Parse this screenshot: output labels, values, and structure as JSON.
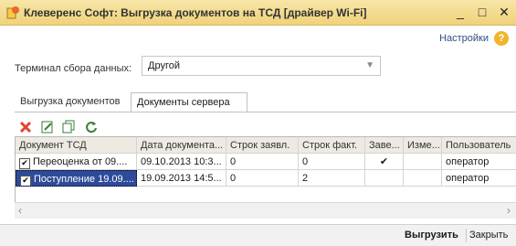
{
  "window": {
    "title": "Клеверенс Софт: Выгрузка документов на ТСД [драйвер Wi-Fi]",
    "minimize": "_",
    "maximize": "□",
    "close": "✕"
  },
  "header": {
    "settings_label": "Настройки",
    "help": "?"
  },
  "terminal": {
    "label": "Терминал сбора данных:",
    "value": "Другой"
  },
  "tabs": [
    {
      "label": "Выгрузка документов"
    },
    {
      "label": "Документы сервера"
    }
  ],
  "toolbar": {
    "icons": [
      "delete-icon",
      "edit-icon",
      "copy-icon",
      "refresh-icon"
    ]
  },
  "table": {
    "columns": [
      "Документ ТСД",
      "Дата документа...",
      "Строк заявл.",
      "Строк факт.",
      "Заве...",
      "Изме...",
      "Пользователь"
    ],
    "rows": [
      {
        "doc": "Переоценка от 09....",
        "date": "09.10.2013 10:3...",
        "declared": "0",
        "actual": "0",
        "done": "✔",
        "changed": "",
        "user": "оператор",
        "checked": "✔"
      },
      {
        "doc": "Поступление 19.09....",
        "date": "19.09.2013 14:5...",
        "declared": "0",
        "actual": "2",
        "done": "",
        "changed": "",
        "user": "оператор",
        "checked": "✔"
      }
    ]
  },
  "footer": {
    "export_label": "Выгрузить",
    "close_label": "Закрыть"
  }
}
